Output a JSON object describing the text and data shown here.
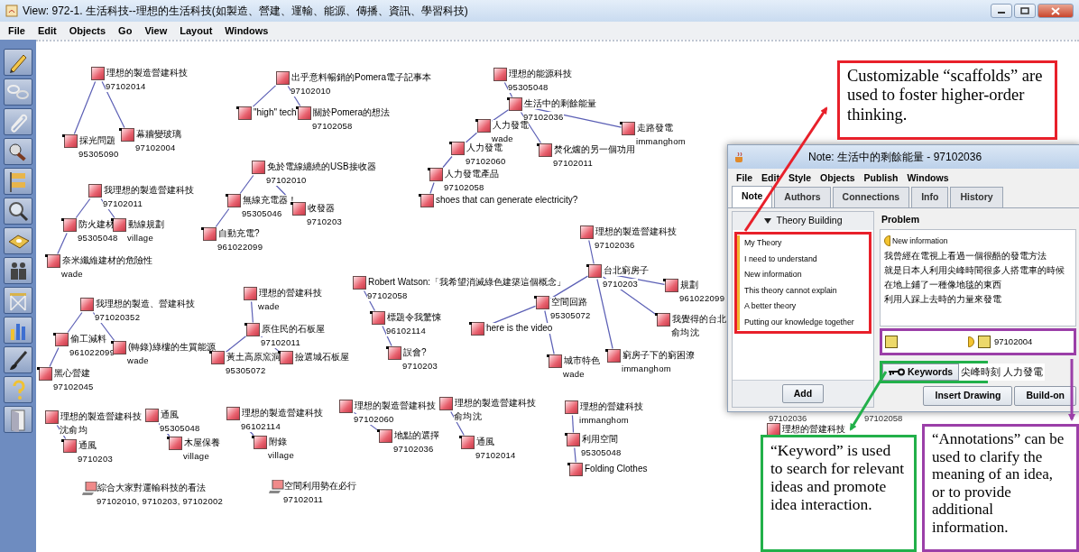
{
  "window": {
    "title": "View: 972-1. 生活科技--理想的生活科技(如製造、營建、運輸、能源、傳播、資訊、學習科技)"
  },
  "menu": [
    "File",
    "Edit",
    "Objects",
    "Go",
    "View",
    "Layout",
    "Windows"
  ],
  "map": {
    "notes": [
      {
        "kind": "note",
        "title": "理想的製造營建科技",
        "author": "97102014",
        "children": [
          {
            "kind": "note",
            "title": "採光問題",
            "author": "95305090"
          },
          {
            "kind": "note",
            "title": "幕牆變玻璃",
            "author": "97102004"
          }
        ]
      },
      {
        "kind": "note",
        "title": "出乎意料暢銷的Pomera電子記事本",
        "author": "97102010",
        "children": [
          {
            "kind": "note",
            "title": "\"high\" tech"
          },
          {
            "kind": "note",
            "title": "關於Pomera的想法",
            "author": "97102058"
          }
        ]
      },
      {
        "kind": "note",
        "title": "理想的能源科技",
        "author": "95305048",
        "children": [
          {
            "kind": "note",
            "title": "生活中的剩餘能量",
            "author": "97102036",
            "children": [
              {
                "kind": "note",
                "title": "人力發電",
                "author": "wade",
                "children": [
                  {
                    "kind": "note",
                    "title": "人力發電",
                    "author": "97102060",
                    "children": [
                      {
                        "kind": "note",
                        "title": "人力發電產品",
                        "author": "97102058",
                        "children": [
                          {
                            "kind": "note",
                            "title": "shoes that can generate electricity?"
                          }
                        ]
                      }
                    ]
                  }
                ]
              },
              {
                "kind": "note",
                "title": "走路發電",
                "author": "immanghom"
              },
              {
                "kind": "note",
                "title": "焚化爐的另一個功用",
                "author": "97102011"
              }
            ]
          }
        ]
      },
      {
        "kind": "note",
        "title": "免於電線纏繞的USB接收器",
        "author": "97102010",
        "children": [
          {
            "kind": "note",
            "title": "無線充電器！",
            "author": "95305046",
            "children": [
              {
                "kind": "note",
                "title": "自動充電?",
                "author": "961022099"
              }
            ]
          },
          {
            "kind": "note",
            "title": "收發器",
            "author": "9710203"
          }
        ]
      },
      {
        "kind": "note",
        "title": "我理想的製造營建科技",
        "author": "97102011",
        "children": [
          {
            "kind": "note",
            "title": "防火建材",
            "author": "95305048",
            "children": [
              {
                "kind": "note",
                "title": "奈米纖維建材的危險性",
                "author": "wade"
              }
            ]
          },
          {
            "kind": "note",
            "title": "動線規劃",
            "author": "village"
          }
        ]
      },
      {
        "kind": "note",
        "title": "我理想的製造、營建科技",
        "author": "971020352",
        "children": [
          {
            "kind": "note",
            "title": "偷工減料",
            "author": "961022099",
            "children": [
              {
                "kind": "note",
                "title": "黑心營建",
                "author": "97102045"
              }
            ]
          },
          {
            "kind": "note",
            "title": "(轉錄)綠樓的生質能源",
            "author": "wade"
          }
        ]
      },
      {
        "kind": "note",
        "title": "理想的營建科技",
        "author": "wade",
        "children": [
          {
            "kind": "note",
            "title": "原住民的石板屋",
            "author": "97102011",
            "children": [
              {
                "kind": "note",
                "title": "黃土高原窯洞",
                "author": "95305072"
              },
              {
                "kind": "note",
                "title": "撿選城石板屋"
              }
            ]
          }
        ]
      },
      {
        "kind": "note",
        "title": "Robert Watson:「我希望消滅綠色建築這個概念」",
        "author": "97102058",
        "children": [
          {
            "kind": "note",
            "title": "標題令我驚悚",
            "author": "96102114",
            "children": [
              {
                "kind": "note",
                "title": "誤會?",
                "author": "9710203"
              }
            ]
          }
        ]
      },
      {
        "kind": "note",
        "title": "理想的製造營建科技",
        "author": "97102036",
        "children": [
          {
            "kind": "note",
            "title": "台北窮房子",
            "author": "9710203",
            "children": [
              {
                "kind": "note",
                "title": "空間回路",
                "author": "95305072",
                "children": [
                  {
                    "kind": "note",
                    "title": "here is the video"
                  },
                  {
                    "kind": "note",
                    "title": "城市特色",
                    "author": "wade"
                  }
                ]
              },
              {
                "kind": "note",
                "title": "規劃",
                "author": "961022099"
              },
              {
                "kind": "note",
                "title": "我覺得的台北",
                "author": "俞均沈"
              },
              {
                "kind": "note",
                "title": "窮房子下的窮困潦",
                "author": "immanghom"
              }
            ]
          }
        ]
      },
      {
        "kind": "note",
        "title": "理想的製造營建科技",
        "author": "沈俞均",
        "children": [
          {
            "kind": "note",
            "title": "通風",
            "author": "9710203"
          }
        ]
      },
      {
        "kind": "note",
        "title": "通風",
        "author": "95305048",
        "children": [
          {
            "kind": "note",
            "title": "木屋保養",
            "author": "village"
          }
        ]
      },
      {
        "kind": "note",
        "title": "理想的製造營建科技",
        "author": "96102114",
        "children": [
          {
            "kind": "note",
            "title": "附錄",
            "author": "village"
          }
        ]
      },
      {
        "kind": "note",
        "title": "理想的製造營建科技",
        "author": "97102060",
        "children": [
          {
            "kind": "note",
            "title": "地點的選擇",
            "author": "97102036"
          }
        ]
      },
      {
        "kind": "note",
        "title": "理想的製造營建科技",
        "author": "俞均沈",
        "children": [
          {
            "kind": "note",
            "title": "通風",
            "author": "97102014"
          }
        ]
      },
      {
        "kind": "note",
        "title": "理想的營建科技",
        "author": "immanghom",
        "children": [
          {
            "kind": "note",
            "title": "利用空間",
            "author": "95305048",
            "children": [
              {
                "kind": "note",
                "title": "Folding Clothes"
              }
            ]
          }
        ]
      },
      {
        "kind": "view",
        "title": "綜合大家對運輸科技的看法",
        "author": "97102010, 9710203, 97102002"
      },
      {
        "kind": "view",
        "title": "空間利用勢在必行",
        "author": "97102011"
      },
      {
        "kind": "note",
        "title": "理想的營建科技"
      }
    ],
    "peeking_labels": [
      "97102036",
      "97102058"
    ]
  },
  "note_window": {
    "title": "Note: 生活中的剩餘能量 - 97102036",
    "menu": [
      "File",
      "Edit",
      "Style",
      "Objects",
      "Publish",
      "Windows"
    ],
    "tabs": [
      {
        "label": "Note",
        "selected": true
      },
      {
        "label": "Authors",
        "selected": false
      },
      {
        "label": "Connections",
        "selected": false
      },
      {
        "label": "Info",
        "selected": false
      },
      {
        "label": "History",
        "selected": false
      }
    ],
    "scaffold_set": "Theory Building",
    "scaffolds": [
      "My Theory",
      "I need to understand",
      "New information",
      "This theory cannot explain",
      "A better theory",
      "Putting our knowledge together"
    ],
    "add_button": "Add",
    "problem_label": "Problem",
    "scaffold_tag": "New information",
    "text_lines": [
      "我曾經在電視上看過一個很酷的發電方法",
      "就是日本人利用尖峰時間很多人搭電車的時候",
      "在地上鋪了一種像地毯的東西",
      "利用人踩上去時的力量來發電"
    ],
    "annotation_ref": "97102004",
    "keywords_button": "Keywords",
    "keywords": "尖峰時刻 人力發電",
    "buttons": [
      "Insert Drawing",
      "Build-on"
    ]
  },
  "callouts": [
    {
      "text": "Customizable “scaffolds” are used to foster higher-order thinking.",
      "color": "#e8202a"
    },
    {
      "text": "“Keyword” is used to search for relevant ideas and promote idea interaction.",
      "color": "#22b04a"
    },
    {
      "text": "“Annotations” can be used to clarify the meaning of an idea, or to provide additional information.",
      "color": "#9b3fa8"
    }
  ]
}
